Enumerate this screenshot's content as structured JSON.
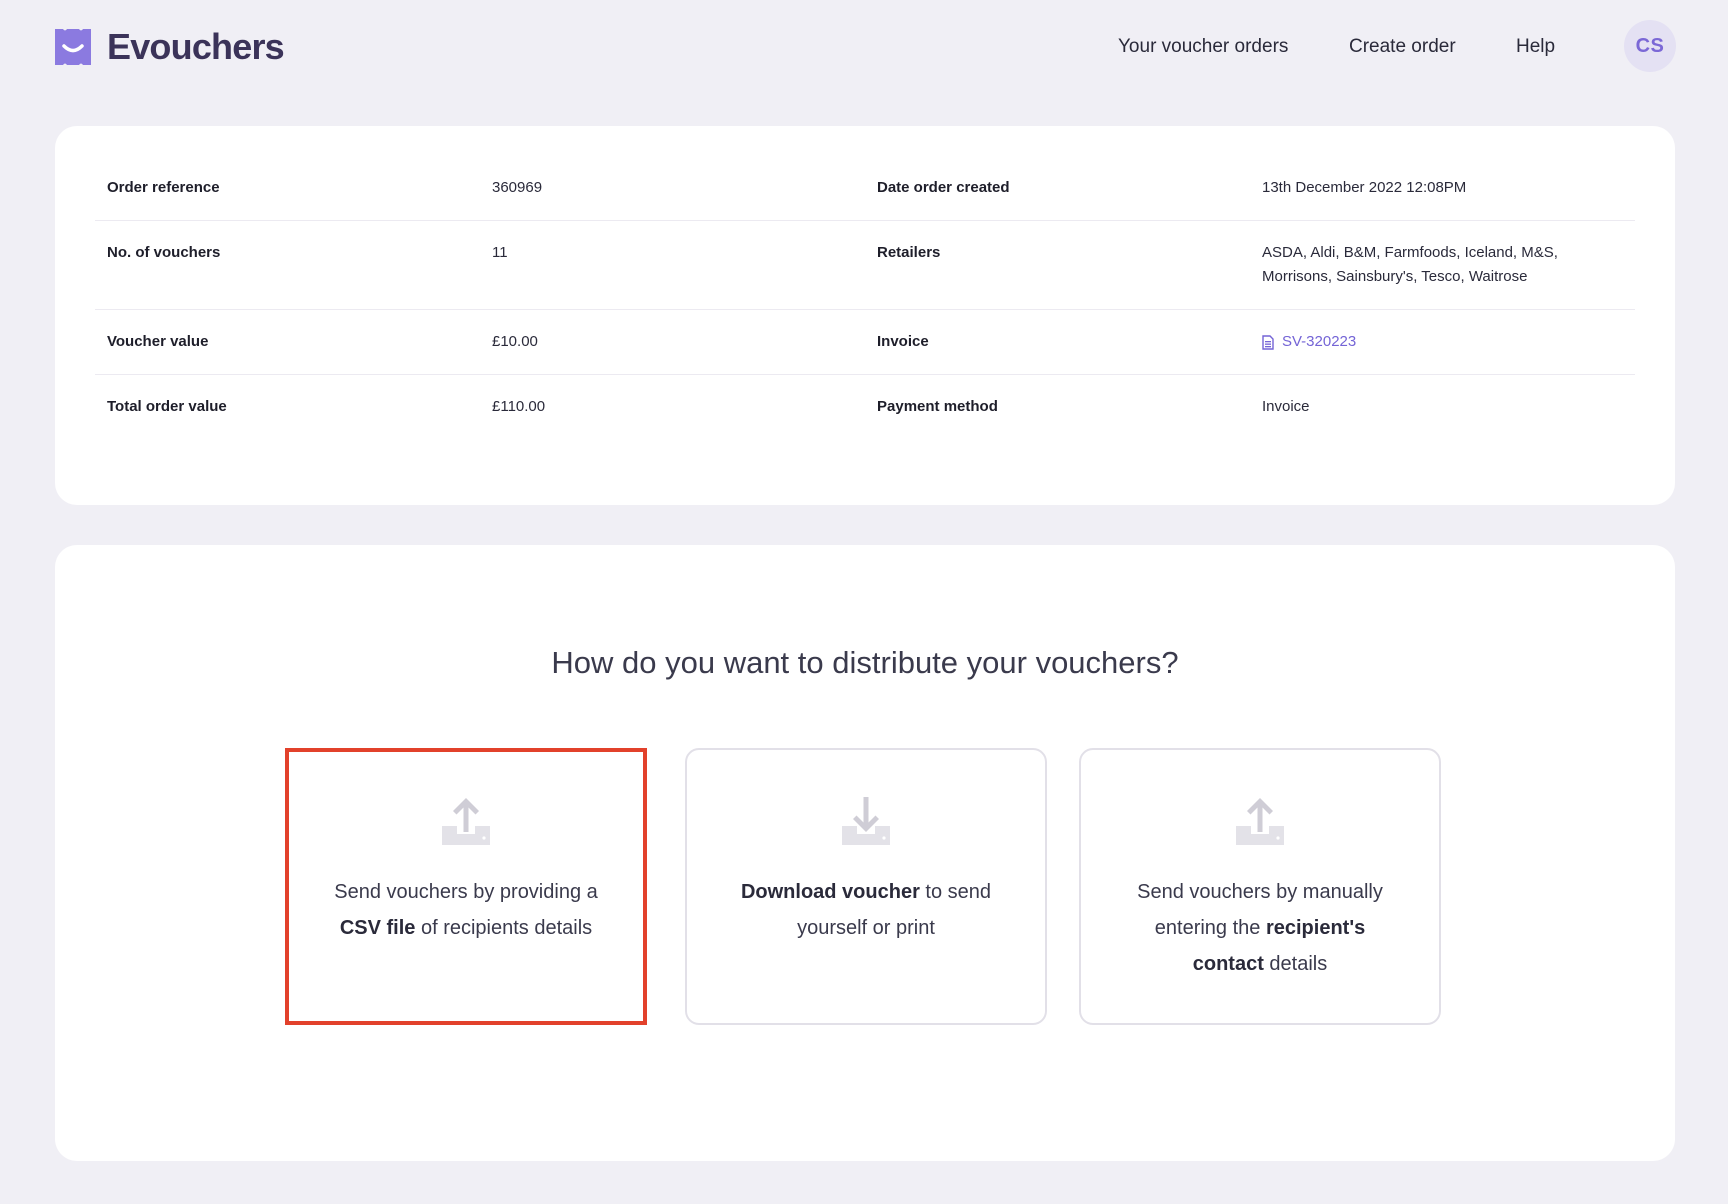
{
  "app": {
    "name": "Evouchers",
    "brand_color": "#7b68d6"
  },
  "nav": {
    "items": [
      {
        "label": "Your voucher orders"
      },
      {
        "label": "Create order"
      },
      {
        "label": "Help"
      }
    ],
    "avatar_initials": "CS"
  },
  "order": {
    "rows": [
      {
        "label_left": "Order reference",
        "value_left": "360969",
        "label_right": "Date order created",
        "value_right": "13th December 2022 12:08PM"
      },
      {
        "label_left": "No. of vouchers",
        "value_left": "11",
        "label_right": "Retailers",
        "value_right": "ASDA, Aldi, B&M, Farmfoods, Iceland, M&S, Morrisons, Sainsbury's, Tesco, Waitrose"
      },
      {
        "label_left": "Voucher value",
        "value_left": "£10.00",
        "label_right": "Invoice",
        "value_right": "SV-320223",
        "value_right_icon": "document-icon"
      },
      {
        "label_left": "Total order value",
        "value_left": "£110.00",
        "label_right": "Payment method",
        "value_right": "Invoice"
      }
    ]
  },
  "distribute": {
    "title": "How do you want to distribute your vouchers?",
    "options": [
      {
        "icon": "upload-icon",
        "text_1": "Send vouchers by providing a ",
        "bold_1": "CSV file",
        "text_2": " of recipients details",
        "bold_2": "",
        "text_3": "",
        "selected": true
      },
      {
        "icon": "download-icon",
        "text_1": "",
        "bold_1": "Download voucher",
        "text_2": " to send yourself or print",
        "bold_2": "",
        "text_3": "",
        "selected": false
      },
      {
        "icon": "upload-icon",
        "text_1": "Send vouchers by manually entering the ",
        "bold_1": "recipient's contact",
        "text_2": " details",
        "bold_2": "",
        "text_3": "",
        "selected": false
      }
    ]
  }
}
